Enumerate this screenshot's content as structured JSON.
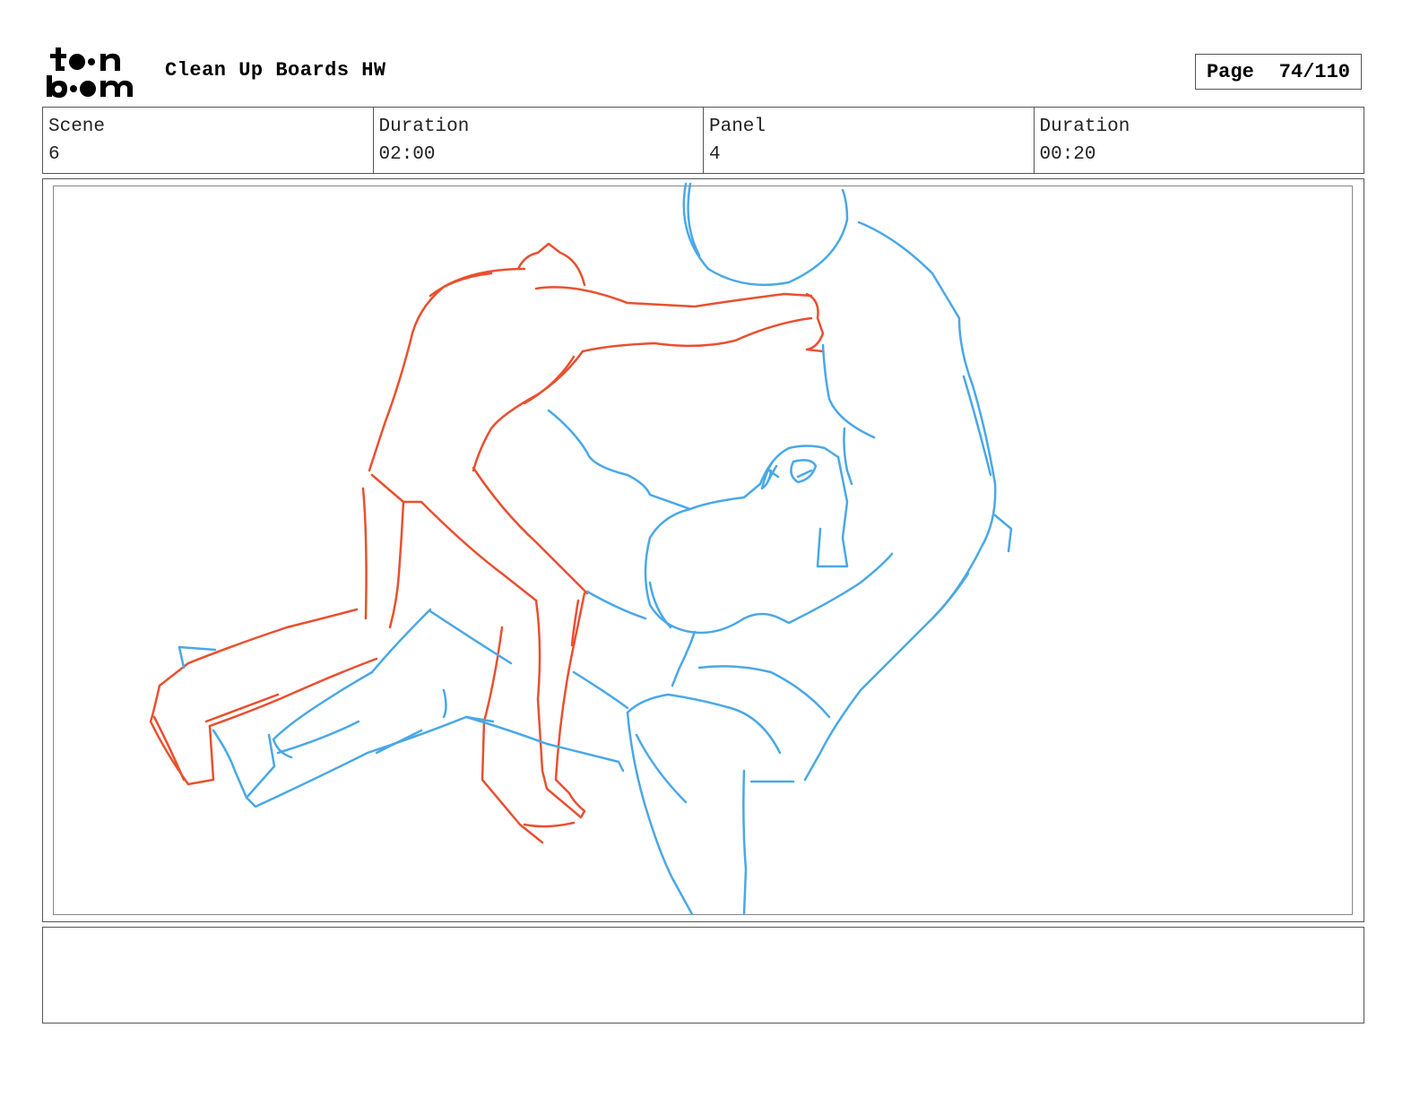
{
  "header": {
    "logo_text": "toon boom",
    "title": "Clean Up Boards HW",
    "page_label": "Page",
    "page_value": "74/110"
  },
  "info": {
    "scene_label": "Scene",
    "scene_value": "6",
    "scene_duration_label": "Duration",
    "scene_duration_value": "02:00",
    "panel_label": "Panel",
    "panel_value": "4",
    "panel_duration_label": "Duration",
    "panel_duration_value": "00:20"
  },
  "panel": {
    "sketch_colors": {
      "red": "#e8502f",
      "blue": "#4aa8e6"
    }
  },
  "notes": {
    "text": ""
  }
}
